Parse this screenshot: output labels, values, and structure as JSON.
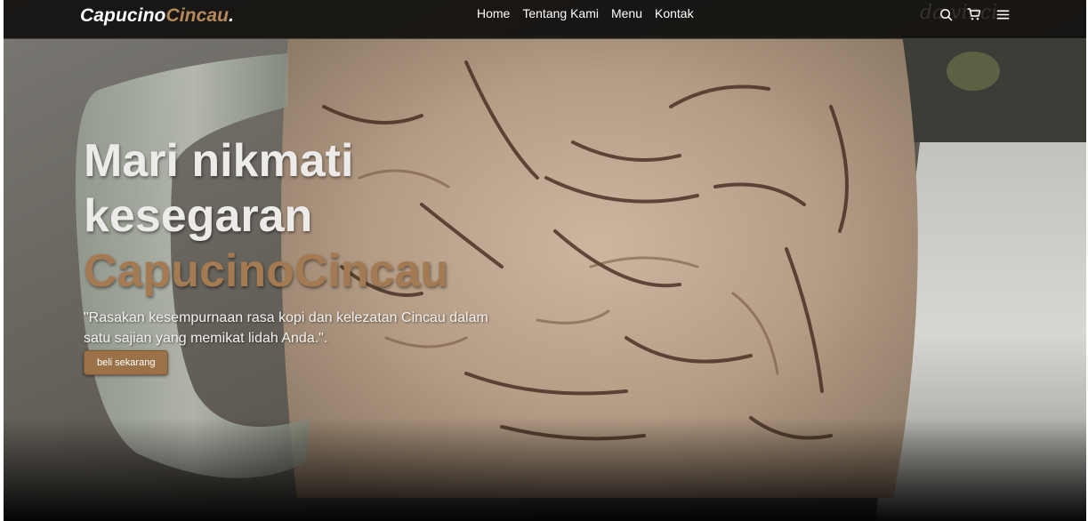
{
  "header": {
    "brand": {
      "main": "Capucino",
      "accent": "Cincau",
      "dot": "."
    },
    "nav": [
      {
        "label": "Home"
      },
      {
        "label": "Tentang Kami"
      },
      {
        "label": "Menu"
      },
      {
        "label": "Kontak"
      }
    ],
    "icons": [
      "search-icon",
      "shopping-cart-icon",
      "menu-icon"
    ]
  },
  "hero": {
    "title_line1": "Mari nikmati",
    "title_line2": "kesegaran",
    "title_brand": "CapucinoCincau",
    "description": "\"Rasakan kesempurnaan rasa kopi dan kelezatan Cincau dalam satu sajian yang memikat lidah Anda.\".",
    "cta_label": "beli sekarang"
  },
  "colors": {
    "accent": "#a47a52",
    "navbar": "#12100e",
    "button": "#9b7248",
    "text": "#ffffff"
  }
}
